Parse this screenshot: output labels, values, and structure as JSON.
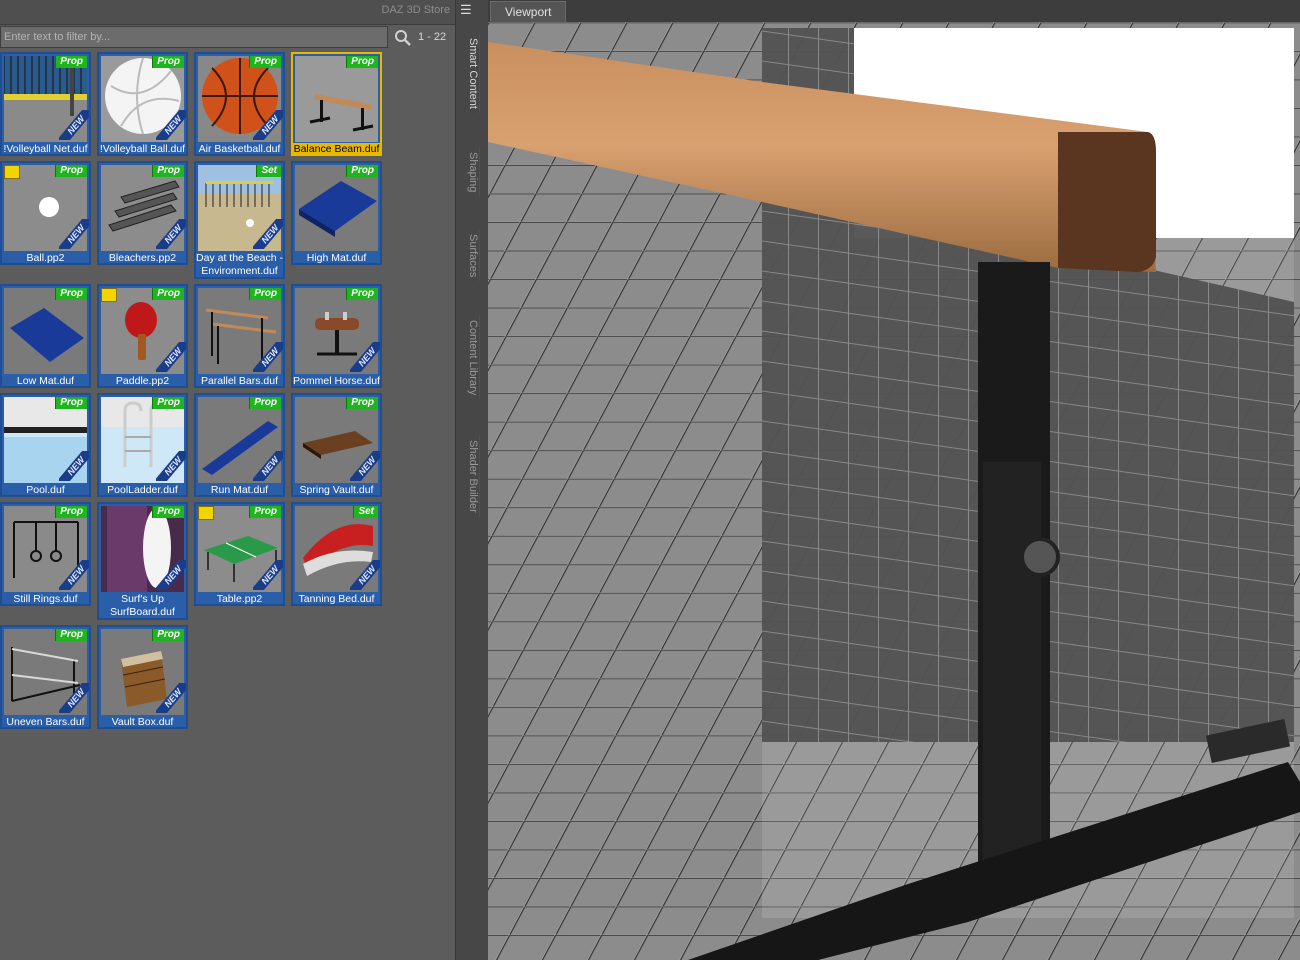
{
  "store": {
    "tab_label": "DAZ 3D Store"
  },
  "filter": {
    "placeholder": "Enter text to filter by...",
    "count": "1 - 22"
  },
  "side_tabs": [
    "Smart Content",
    "Shaping",
    "Surfaces",
    "Content Library",
    "Shader Builder"
  ],
  "viewport": {
    "tab_label": "Viewport"
  },
  "badges": {
    "new": "NEW"
  },
  "items": [
    {
      "label": "!Volleyball Net.duf",
      "badge": "Prop",
      "new": true,
      "tool": false,
      "icon": "volleyball-net-thumb"
    },
    {
      "label": "!Volleyball Ball.duf",
      "badge": "Prop",
      "new": true,
      "tool": false,
      "icon": "volleyball-thumb"
    },
    {
      "label": "Air Basketball.duf",
      "badge": "Prop",
      "new": true,
      "tool": false,
      "icon": "basketball-thumb"
    },
    {
      "label": "Balance Beam.duf",
      "badge": "Prop",
      "new": false,
      "tool": false,
      "icon": "balance-beam-thumb",
      "selected": true
    },
    {
      "label": "Ball.pp2",
      "badge": "Prop",
      "new": true,
      "tool": true,
      "icon": "ball-thumb"
    },
    {
      "label": "Bleachers.pp2",
      "badge": "Prop",
      "new": true,
      "tool": false,
      "icon": "bleachers-thumb"
    },
    {
      "label": "Day at the Beach -\nEnvironment.duf",
      "badge": "Set",
      "new": true,
      "tool": false,
      "icon": "beach-thumb"
    },
    {
      "label": "High Mat.duf",
      "badge": "Prop",
      "new": false,
      "tool": false,
      "icon": "high-mat-thumb"
    },
    {
      "label": "Low Mat.duf",
      "badge": "Prop",
      "new": false,
      "tool": false,
      "icon": "low-mat-thumb"
    },
    {
      "label": "Paddle.pp2",
      "badge": "Prop",
      "new": true,
      "tool": true,
      "icon": "paddle-thumb"
    },
    {
      "label": "Parallel Bars.duf",
      "badge": "Prop",
      "new": true,
      "tool": false,
      "icon": "parallel-bars-thumb"
    },
    {
      "label": "Pommel Horse.duf",
      "badge": "Prop",
      "new": true,
      "tool": false,
      "icon": "pommel-horse-thumb"
    },
    {
      "label": "Pool.duf",
      "badge": "Prop",
      "new": true,
      "tool": false,
      "icon": "pool-thumb"
    },
    {
      "label": "PoolLadder.duf",
      "badge": "Prop",
      "new": true,
      "tool": false,
      "icon": "pool-ladder-thumb"
    },
    {
      "label": "Run Mat.duf",
      "badge": "Prop",
      "new": true,
      "tool": false,
      "icon": "run-mat-thumb"
    },
    {
      "label": "Spring Vault.duf",
      "badge": "Prop",
      "new": true,
      "tool": false,
      "icon": "spring-vault-thumb"
    },
    {
      "label": "Still Rings.duf",
      "badge": "Prop",
      "new": true,
      "tool": false,
      "icon": "still-rings-thumb"
    },
    {
      "label": "Surf's Up\nSurfBoard.duf",
      "badge": "Prop",
      "new": true,
      "tool": false,
      "icon": "surfboard-thumb"
    },
    {
      "label": "Table.pp2",
      "badge": "Prop",
      "new": true,
      "tool": true,
      "icon": "table-thumb"
    },
    {
      "label": "Tanning Bed.duf",
      "badge": "Set",
      "new": true,
      "tool": false,
      "icon": "tanning-bed-thumb"
    },
    {
      "label": "Uneven Bars.duf",
      "badge": "Prop",
      "new": true,
      "tool": false,
      "icon": "uneven-bars-thumb"
    },
    {
      "label": "Vault Box.duf",
      "badge": "Prop",
      "new": true,
      "tool": false,
      "icon": "vault-box-thumb"
    }
  ]
}
